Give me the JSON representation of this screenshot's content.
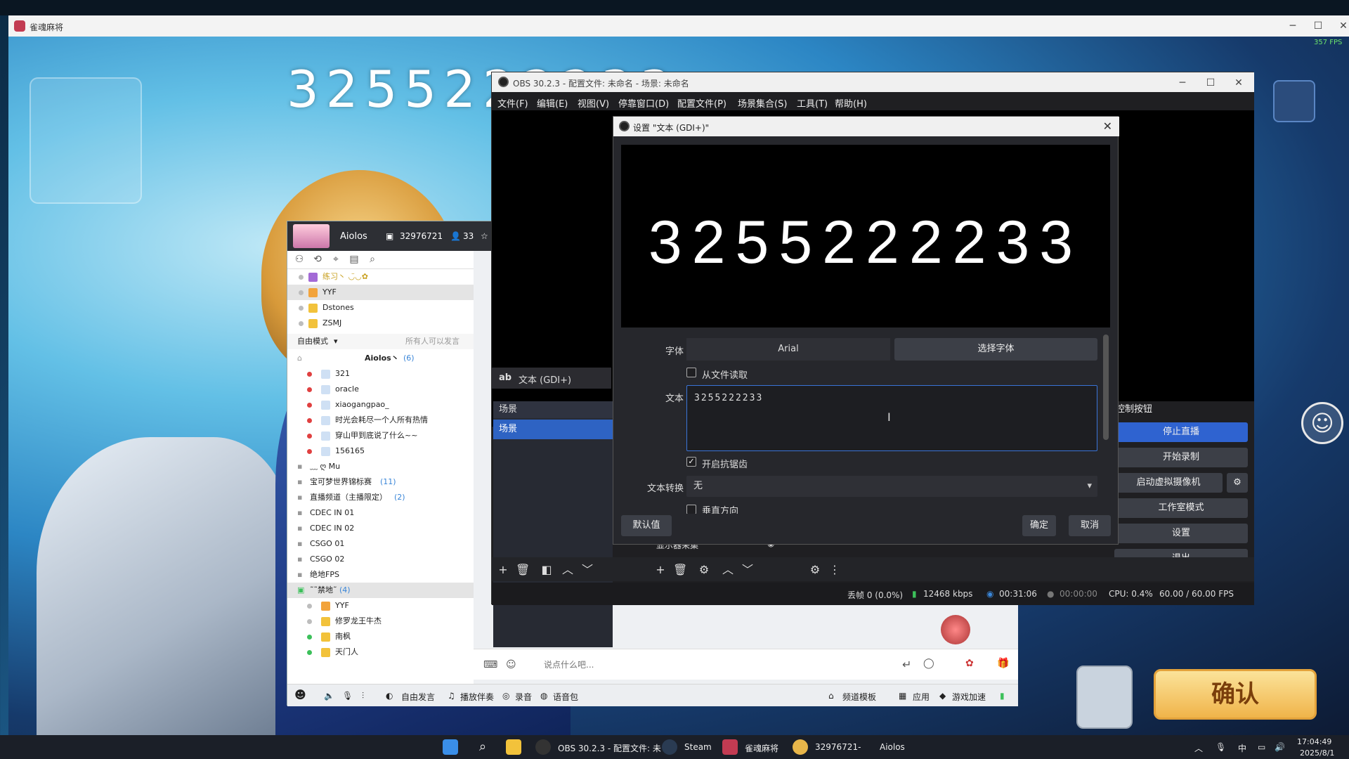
{
  "game": {
    "title": "雀魂麻将",
    "fps": "357 FPS",
    "overlay_number": "3255222233",
    "confirm_label": "确认"
  },
  "yy": {
    "username": "Aiolos",
    "channel_id": "32976721",
    "online_count": "33",
    "mode_label": "自由模式",
    "mode_hint": "所有人可以发言",
    "list": [
      {
        "name": "练习丶 ◡̈◡✿",
        "dot": "#bdbdbd",
        "icon": "#a36ad6"
      },
      {
        "name": "YYF",
        "dot": "#bdbdbd",
        "icon": "#f2a33b"
      },
      {
        "name": "Dstones",
        "dot": "#bdbdbd",
        "icon": "#f2c23b"
      },
      {
        "name": "ZSMJ",
        "dot": "#bdbdbd",
        "icon": "#f2c23b"
      }
    ],
    "owner_row": {
      "name": "Aiolos丶",
      "count": "(6)"
    },
    "users": [
      {
        "name": "321",
        "dot": "#e04040"
      },
      {
        "name": "oracle",
        "dot": "#e04040"
      },
      {
        "name": "xiaogangpao_",
        "dot": "#e04040"
      },
      {
        "name": "时光会耗尽一个人所有热情",
        "dot": "#e04040"
      },
      {
        "name": "穿山甲到底说了什么~~",
        "dot": "#e04040"
      },
      {
        "name": "156165",
        "dot": "#e04040"
      }
    ],
    "channels": [
      {
        "name": "﹏  ღ  Mu",
        "count": ""
      },
      {
        "name": "宝可梦世界锦标赛",
        "count": "(11)"
      },
      {
        "name": "直播频道（主播限定）",
        "count": "(2)"
      },
      {
        "name": "CDEC IN 01",
        "count": ""
      },
      {
        "name": "CDEC IN 02",
        "count": ""
      },
      {
        "name": "CSGO 01",
        "count": ""
      },
      {
        "name": "CSGO 02",
        "count": ""
      },
      {
        "name": "绝地FPS",
        "count": ""
      }
    ],
    "banned": {
      "name": "˜˜禁地˜",
      "count": "(4)"
    },
    "banned_users": [
      {
        "name": "YYF",
        "dot": "#bdbdbd"
      },
      {
        "name": "修罗龙王牛杰",
        "dot": "#bdbdbd"
      },
      {
        "name": "南枫",
        "dot": "#3cc05a"
      },
      {
        "name": "天门人",
        "dot": "#3cc05a"
      }
    ],
    "chat_placeholder": "说点什么吧...",
    "bottom": {
      "free_speech": "自由发言",
      "player": "播放伴奏",
      "record": "录音",
      "voice_pack": "语音包",
      "channel_template": "频道模板",
      "apps": "应用",
      "game_boost": "游戏加速"
    }
  },
  "obs": {
    "title": "OBS 30.2.3 - 配置文件: 未命名 - 场景: 未命名",
    "menu": [
      "文件(F)",
      "编辑(E)",
      "视图(V)",
      "停靠窗口(D)",
      "配置文件(P)",
      "场景集合(S)",
      "工具(T)",
      "帮助(H)"
    ],
    "source_label": "文本 (GDI+)",
    "scenes_header": "场景",
    "scene_item": "场景",
    "controls_header": "控制按钮",
    "controls": [
      "停止直播",
      "开始录制",
      "启动虚拟摄像机",
      "工作室模式",
      "设置",
      "退出"
    ],
    "mixer_item": "显示器采集",
    "status": {
      "dropped": "丢帧 0 (0.0%)",
      "bitrate": "12468 kbps",
      "live_time": "00:31:06",
      "rec_time": "00:00:00",
      "cpu": "CPU: 0.4%",
      "fps": "60.00 / 60.00 FPS"
    }
  },
  "dialog": {
    "title": "设置 \"文本 (GDI+)\"",
    "preview_text": "3255222233",
    "font_label": "字体",
    "font_value": "Arial",
    "choose_font": "选择字体",
    "read_from_file": "从文件读取",
    "text_label": "文本",
    "text_value": "3255222233",
    "antialias": "开启抗锯齿",
    "transform_label": "文本转换",
    "transform_value": "无",
    "vertical": "垂直方向",
    "defaults": "默认值",
    "ok": "确定",
    "cancel": "取消"
  },
  "taskbar": {
    "items": [
      "OBS 30.2.3 - 配置文件: 未",
      "Steam",
      "雀魂麻将",
      "32976721-",
      "Aiolos"
    ],
    "ime": "中",
    "time": "17:04:49",
    "date": "2025/8/1"
  }
}
